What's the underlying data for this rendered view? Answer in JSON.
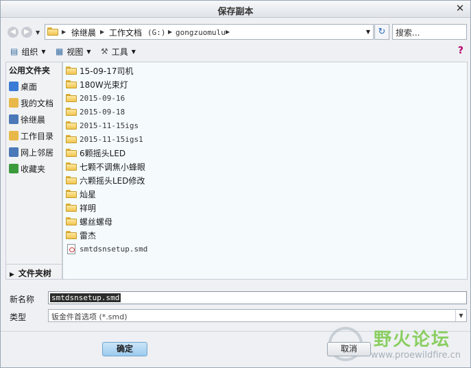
{
  "window": {
    "title": "保存副本",
    "close_glyph": "✕"
  },
  "address": {
    "crumbs": [
      "徐继晨",
      "工作文档",
      "(G:)",
      "gongzuomulu"
    ],
    "search_placeholder": "搜索..."
  },
  "toolbar": {
    "organize": "组织",
    "view": "视图",
    "tools": "工具"
  },
  "sidebar": {
    "header": "公用文件夹",
    "items": [
      {
        "label": "桌面",
        "icon": "desktop-icon",
        "color": "#3a7bd5"
      },
      {
        "label": "我的文档",
        "icon": "my-documents-icon",
        "color": "#e8b84a"
      },
      {
        "label": "徐继晨",
        "icon": "computer-icon",
        "color": "#4a78b8"
      },
      {
        "label": "工作目录",
        "icon": "work-directory-icon",
        "color": "#e8b84a"
      },
      {
        "label": "网上邻居",
        "icon": "network-icon",
        "color": "#4a78b8"
      },
      {
        "label": "收藏夹",
        "icon": "favorites-icon",
        "color": "#3b9a3b"
      }
    ],
    "folder_tree": "文件夹树"
  },
  "files": [
    {
      "name": "15-09-17司机",
      "type": "folder"
    },
    {
      "name": "180W光束灯",
      "type": "folder"
    },
    {
      "name": "2015-09-16",
      "type": "folder"
    },
    {
      "name": "2015-09-18",
      "type": "folder"
    },
    {
      "name": "2015-11-15igs",
      "type": "folder"
    },
    {
      "name": "2015-11-15igs1",
      "type": "folder"
    },
    {
      "name": "6颗摇头LED",
      "type": "folder"
    },
    {
      "name": "七颗不调焦小蜂眼",
      "type": "folder"
    },
    {
      "name": "六颗摇头LED修改",
      "type": "folder"
    },
    {
      "name": "灿星",
      "type": "folder"
    },
    {
      "name": "祥明",
      "type": "folder"
    },
    {
      "name": "螺丝螺母",
      "type": "folder"
    },
    {
      "name": "雷杰",
      "type": "folder"
    },
    {
      "name": "smtdsnsetup.smd",
      "type": "file"
    }
  ],
  "form": {
    "name_label": "新名称",
    "name_value": "smtdsnsetup.smd",
    "type_label": "类型",
    "type_value": "钣金件首选项 (*.smd)"
  },
  "buttons": {
    "ok": "确定",
    "cancel": "取消"
  },
  "watermark": {
    "text": "野火论坛",
    "url": "www.proewildfire.cn"
  }
}
